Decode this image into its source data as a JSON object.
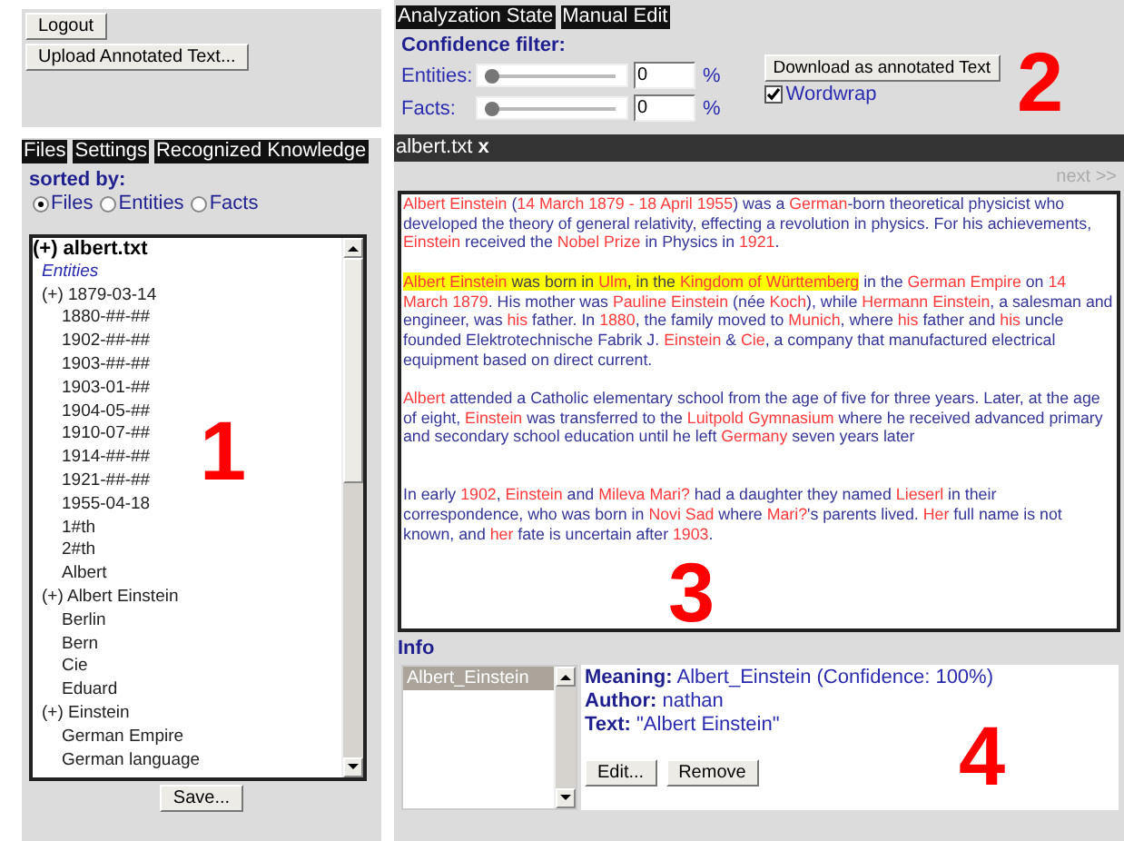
{
  "left_toolbar": {
    "buttons": [
      "Logout",
      "Upload Annotated Text..."
    ]
  },
  "left_tabs": [
    {
      "label": "Files"
    },
    {
      "label": "Settings"
    },
    {
      "label": "Recognized Knowledge"
    }
  ],
  "sort": {
    "label": "sorted by:",
    "options": [
      {
        "label": "Files",
        "selected": true
      },
      {
        "label": "Entities",
        "selected": false
      },
      {
        "label": "Facts",
        "selected": false
      }
    ]
  },
  "tree": [
    {
      "marker": "(+)",
      "label": "albert.txt",
      "section": "Entities",
      "children": [
        {
          "marker": "(+)",
          "label": "1879-03-14"
        },
        {
          "label": "1880-##-##"
        },
        {
          "label": "1902-##-##"
        },
        {
          "label": "1903-##-##"
        },
        {
          "label": "1903-01-##"
        },
        {
          "label": "1904-05-##"
        },
        {
          "label": "1910-07-##"
        },
        {
          "label": "1914-##-##"
        },
        {
          "label": "1921-##-##"
        },
        {
          "label": "1955-04-18"
        },
        {
          "label": "1#th"
        },
        {
          "label": "2#th"
        },
        {
          "label": "Albert"
        },
        {
          "marker": "(+)",
          "label": "Albert Einstein"
        },
        {
          "label": "Berlin"
        },
        {
          "label": "Bern"
        },
        {
          "label": "Cie"
        },
        {
          "label": "Eduard"
        },
        {
          "marker": "(+)",
          "label": "Einstein"
        },
        {
          "label": "German Empire"
        },
        {
          "label": "German language"
        }
      ]
    }
  ],
  "save_button": "Save...",
  "right_tabs": [
    {
      "label": "Analyzation State"
    },
    {
      "label": "Manual Edit"
    }
  ],
  "confidence_filter": {
    "title": "Confidence filter:",
    "sliders": [
      {
        "label": "Entities:",
        "level": 0,
        "value": "0",
        "unit": "%"
      },
      {
        "label": "Facts:",
        "level": 0,
        "value": "0",
        "unit": "%"
      }
    ]
  },
  "download_button": "Download as annotated Text",
  "wordwrap": {
    "label": "Wordwrap",
    "checked": true
  },
  "document_tab": {
    "label": "albert.txt",
    "close": "x"
  },
  "pager": {
    "next": "next >>"
  },
  "paragraphs": [
    [
      {
        "t": "Albert Einstein",
        "kind": "entity"
      },
      {
        "t": " (",
        "kind": "text"
      },
      {
        "t": "14 March 1879 - 18 April 1955",
        "kind": "entity"
      },
      {
        "t": ") was a ",
        "kind": "text"
      },
      {
        "t": "German",
        "kind": "entity"
      },
      {
        "t": "-born theoretical physicist who developed the theory of general relativity, effecting a revolution in physics. For his achievements, ",
        "kind": "text"
      },
      {
        "t": "Einstein",
        "kind": "entity"
      },
      {
        "t": " received the ",
        "kind": "text"
      },
      {
        "t": "Nobel Prize",
        "kind": "entity"
      },
      {
        "t": " in Physics in ",
        "kind": "text"
      },
      {
        "t": "1921",
        "kind": "entity"
      },
      {
        "t": ".",
        "kind": "text"
      }
    ],
    [
      {
        "t": "Albert Einstein",
        "kind": "marked-entity"
      },
      {
        "t": " was born in ",
        "kind": "marked-text"
      },
      {
        "t": "Ulm",
        "kind": "marked-entity"
      },
      {
        "t": ", in the ",
        "kind": "marked-text"
      },
      {
        "t": "Kingdom of Württemberg",
        "kind": "marked-entity"
      },
      {
        "t": " in the ",
        "kind": "text"
      },
      {
        "t": "German Empire",
        "kind": "entity"
      },
      {
        "t": " on ",
        "kind": "text"
      },
      {
        "t": "14 March 1879",
        "kind": "entity"
      },
      {
        "t": ". His mother was ",
        "kind": "text"
      },
      {
        "t": "Pauline Einstein",
        "kind": "entity"
      },
      {
        "t": " (née ",
        "kind": "text"
      },
      {
        "t": "Koch",
        "kind": "entity"
      },
      {
        "t": "), while ",
        "kind": "text"
      },
      {
        "t": "Hermann Einstein",
        "kind": "entity"
      },
      {
        "t": ", a salesman and engineer, was ",
        "kind": "text"
      },
      {
        "t": "his",
        "kind": "entity"
      },
      {
        "t": " father. In ",
        "kind": "text"
      },
      {
        "t": "1880",
        "kind": "entity"
      },
      {
        "t": ", the family moved to ",
        "kind": "text"
      },
      {
        "t": "Munich",
        "kind": "entity"
      },
      {
        "t": ", where ",
        "kind": "text"
      },
      {
        "t": "his",
        "kind": "entity"
      },
      {
        "t": " father and ",
        "kind": "text"
      },
      {
        "t": "his",
        "kind": "entity"
      },
      {
        "t": " uncle founded Elektrotechnische Fabrik J. ",
        "kind": "text"
      },
      {
        "t": "Einstein",
        "kind": "entity"
      },
      {
        "t": " & ",
        "kind": "text"
      },
      {
        "t": "Cie",
        "kind": "entity"
      },
      {
        "t": ", a company that manufactured electrical equipment based on direct current.",
        "kind": "text"
      }
    ],
    [
      {
        "t": "Albert",
        "kind": "entity"
      },
      {
        "t": " attended a Catholic elementary school from the age of five for three years. Later, at the age of eight, ",
        "kind": "text"
      },
      {
        "t": "Einstein",
        "kind": "entity"
      },
      {
        "t": " was transferred to the ",
        "kind": "text"
      },
      {
        "t": "Luitpold Gymnasium",
        "kind": "entity"
      },
      {
        "t": " where he received advanced primary and secondary school education until he left ",
        "kind": "text"
      },
      {
        "t": "Germany",
        "kind": "entity"
      },
      {
        "t": " seven years later",
        "kind": "text"
      }
    ],
    [
      {
        "t": "In early ",
        "kind": "text"
      },
      {
        "t": "1902",
        "kind": "entity"
      },
      {
        "t": ", ",
        "kind": "text"
      },
      {
        "t": "Einstein",
        "kind": "entity"
      },
      {
        "t": " and ",
        "kind": "text"
      },
      {
        "t": "Mileva Mari?",
        "kind": "entity"
      },
      {
        "t": " had a daughter they named ",
        "kind": "text"
      },
      {
        "t": "Lieserl",
        "kind": "entity"
      },
      {
        "t": " in their correspondence, who was born in ",
        "kind": "text"
      },
      {
        "t": "Novi Sad",
        "kind": "entity"
      },
      {
        "t": " where ",
        "kind": "text"
      },
      {
        "t": "Mari?",
        "kind": "entity"
      },
      {
        "t": "'s parents lived. ",
        "kind": "text"
      },
      {
        "t": "Her",
        "kind": "entity"
      },
      {
        "t": " full name is not known, and ",
        "kind": "text"
      },
      {
        "t": "her",
        "kind": "entity"
      },
      {
        "t": " fate is uncertain after ",
        "kind": "text"
      },
      {
        "t": "1903",
        "kind": "entity"
      },
      {
        "t": ".",
        "kind": "text"
      }
    ]
  ],
  "info": {
    "title": "Info",
    "list": [
      {
        "label": "Albert_Einstein",
        "selected": true
      }
    ],
    "fields": [
      {
        "label": "Meaning:",
        "value": "Albert_Einstein (Confidence: 100%)"
      },
      {
        "label": "Author:",
        "value": "nathan"
      },
      {
        "label": "Text:",
        "value": "\"Albert Einstein\""
      }
    ],
    "buttons": [
      "Edit...",
      "Remove"
    ]
  },
  "callouts": [
    "1",
    "2",
    "3",
    "4"
  ]
}
